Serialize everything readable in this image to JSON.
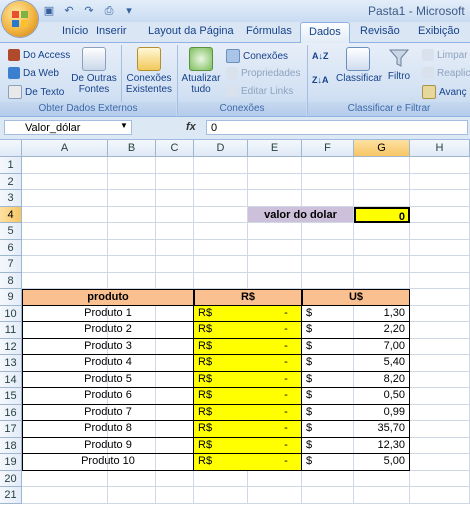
{
  "window": {
    "title": "Pasta1 - Microsoft"
  },
  "qat": {
    "save_icon": "save-icon",
    "undo_icon": "undo-icon",
    "redo_icon": "redo-icon",
    "preview_icon": "print-preview-icon",
    "customize_icon": "customize-icon"
  },
  "tabs": [
    {
      "label": "Início"
    },
    {
      "label": "Inserir"
    },
    {
      "label": "Layout da Página"
    },
    {
      "label": "Fórmulas"
    },
    {
      "label": "Dados",
      "active": true
    },
    {
      "label": "Revisão"
    },
    {
      "label": "Exibição"
    }
  ],
  "ribbon": {
    "external": {
      "access": "Do Access",
      "web": "Da Web",
      "text": "De Texto",
      "other_line1": "De Outras",
      "other_line2": "Fontes",
      "existing_line1": "Conexões",
      "existing_line2": "Existentes",
      "group_label": "Obter Dados Externos"
    },
    "connections": {
      "refresh_line1": "Atualizar",
      "refresh_line2": "tudo",
      "connections": "Conexões",
      "properties": "Propriedades",
      "edit_links": "Editar Links",
      "group_label": "Conexões"
    },
    "sort": {
      "classify": "Classificar",
      "filter": "Filtro",
      "clear": "Limpar",
      "reapply": "Reaplic",
      "advanced": "Avanç",
      "group_label": "Classificar e Filtrar"
    }
  },
  "formula_bar": {
    "name_box": "Valor_dólar",
    "fx": "fx",
    "formula": "0"
  },
  "columns": [
    "A",
    "B",
    "C",
    "D",
    "E",
    "F",
    "G",
    "H"
  ],
  "rows": [
    "1",
    "2",
    "3",
    "4",
    "5",
    "6",
    "7",
    "8",
    "9",
    "10",
    "11",
    "12",
    "13",
    "14",
    "15",
    "16",
    "17",
    "18",
    "19",
    "20",
    "21"
  ],
  "sheet": {
    "dollar_label": "valor do dolar",
    "dollar_value": "0",
    "header_product": "produto",
    "header_brl": "R$",
    "header_usd": "U$",
    "currency_brl": "R$",
    "dash": "-",
    "currency_usd": "$",
    "products": [
      {
        "name": "Produto 1",
        "usd": "1,30"
      },
      {
        "name": "Produto 2",
        "usd": "2,20"
      },
      {
        "name": "Produto 3",
        "usd": "7,00"
      },
      {
        "name": "Produto 4",
        "usd": "5,40"
      },
      {
        "name": "Produto 5",
        "usd": "8,20"
      },
      {
        "name": "Produto 6",
        "usd": "0,50"
      },
      {
        "name": "Produto 7",
        "usd": "0,99"
      },
      {
        "name": "Produto 8",
        "usd": "35,70"
      },
      {
        "name": "Produto 9",
        "usd": "12,30"
      },
      {
        "name": "Produto 10",
        "usd": "5,00"
      }
    ]
  },
  "colors": {
    "header_orange": "#fac08f",
    "label_lavender": "#ccc0da",
    "highlight_yellow": "#ffff00",
    "selected_header": "#f7c565"
  }
}
